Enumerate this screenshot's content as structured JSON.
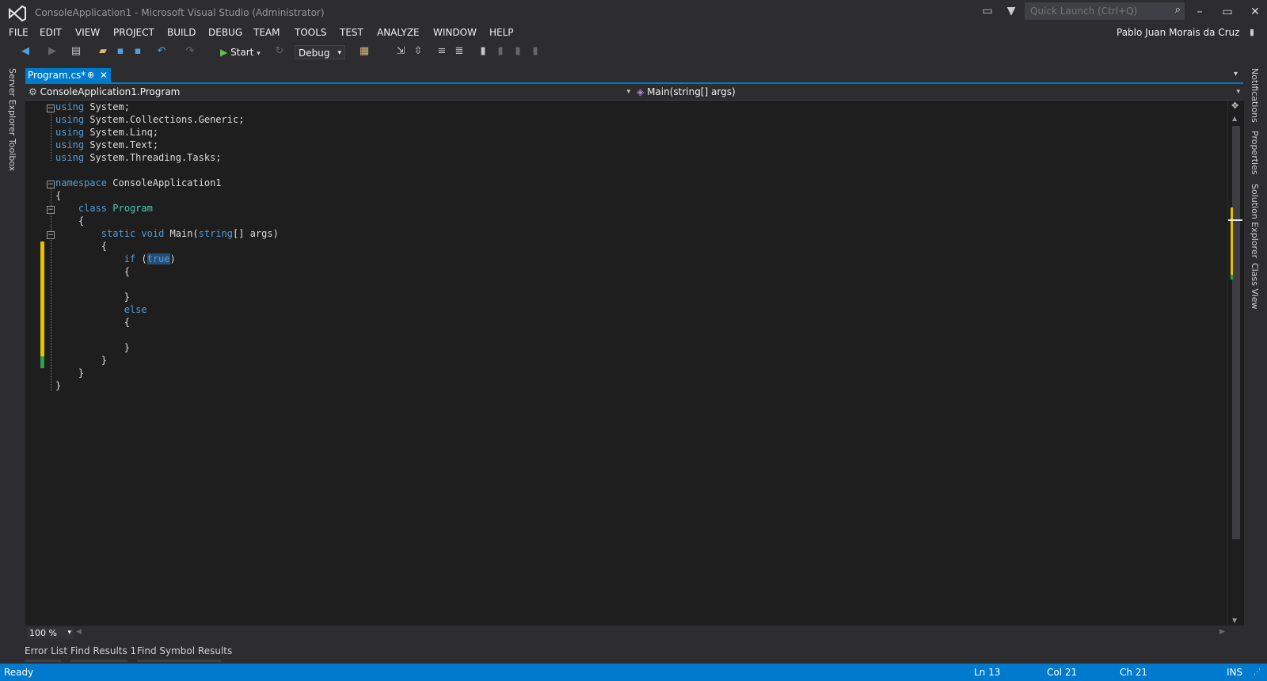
{
  "window": {
    "title": "ConsoleApplication1 - Microsoft Visual Studio (Administrator)",
    "quick_launch_placeholder": "Quick Launch (Ctrl+Q)",
    "user": "Pablo Juan Morais da Cruz"
  },
  "menu": [
    "FILE",
    "EDIT",
    "VIEW",
    "PROJECT",
    "BUILD",
    "DEBUG",
    "TEAM",
    "TOOLS",
    "TEST",
    "ANALYZE",
    "WINDOW",
    "HELP"
  ],
  "toolbar": {
    "start_label": "Start",
    "configuration": "Debug"
  },
  "left_rail": [
    "Server Explorer",
    "Toolbox"
  ],
  "right_rail": [
    "Notifications",
    "Properties",
    "Solution Explorer",
    "Class View"
  ],
  "document_tab": {
    "label": "Program.cs*"
  },
  "navbar": {
    "type_combo": "ConsoleApplication1.Program",
    "member_combo": "Main(string[] args)"
  },
  "code": {
    "lines": [
      "using System;",
      "using System.Collections.Generic;",
      "using System.Linq;",
      "using System.Text;",
      "using System.Threading.Tasks;",
      "",
      "namespace ConsoleApplication1",
      "{",
      "    class Program",
      "    {",
      "        static void Main(string[] args)",
      "        {",
      "            if (true)",
      "            {",
      "",
      "            }",
      "            else",
      "            {",
      "",
      "            }",
      "        }",
      "    }",
      "}"
    ]
  },
  "zoom": "100 %",
  "bottom_tabs": [
    "Error List",
    "Find Results 1",
    "Find Symbol Results"
  ],
  "status": {
    "state": "Ready",
    "line": "Ln 13",
    "col": "Col 21",
    "ch": "Ch 21",
    "mode": "INS"
  },
  "colors": {
    "accent": "#007acc",
    "keyword": "#569cd6",
    "type": "#4ec9b0",
    "changed_margin": "#e5c100",
    "saved_margin": "#2ea043"
  }
}
